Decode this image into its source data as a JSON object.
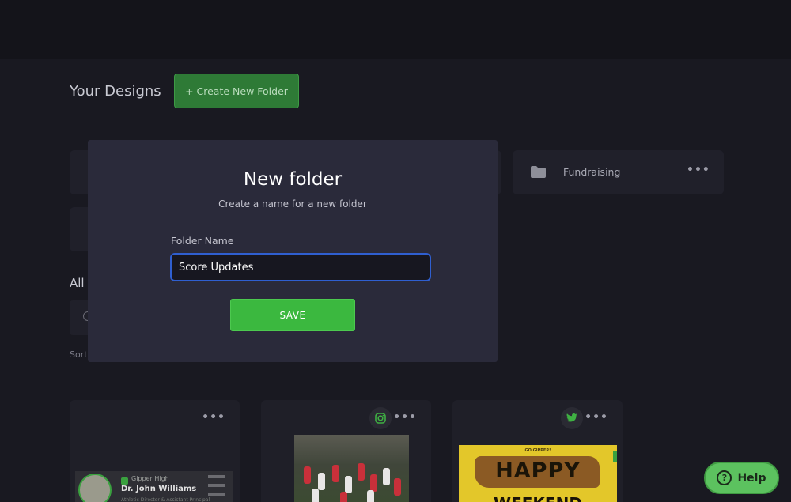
{
  "page": {
    "title": "Your Designs",
    "create_folder_label": "+ Create New Folder",
    "all_label": "All",
    "sort_label": "Sort"
  },
  "folders": [
    {
      "label": "Fundraising",
      "icon": "folder-icon",
      "menu": "•••"
    }
  ],
  "designs": [
    {
      "menu": "•••",
      "school": "Gipper High",
      "person": "Dr. John Williams",
      "role": "Athletic Director & Assistant Principal"
    },
    {
      "menu": "•••",
      "social": "instagram-icon"
    },
    {
      "menu": "•••",
      "social": "twitter-icon",
      "kicker": "GO GIPPER!",
      "headline": "HAPPY",
      "subline": "WEEKEND"
    }
  ],
  "modal": {
    "title": "New folder",
    "subtitle": "Create a name for a new folder",
    "field_label": "Folder Name",
    "field_value": "Score Updates",
    "save_label": "SAVE"
  },
  "help": {
    "label": "Help",
    "icon_glyph": "?"
  },
  "colors": {
    "accent_green": "#3bb83f",
    "focus_blue": "#2f5fd0",
    "modal_bg": "#2a2a3a",
    "page_bg": "#191921"
  }
}
